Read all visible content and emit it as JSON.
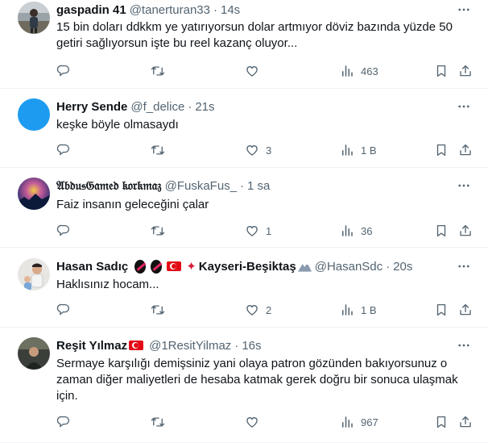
{
  "tweets": [
    {
      "name": "gaspadin 41",
      "handle": "@tanerturan33",
      "time": "14s",
      "text_lines": [
        "15 bin doları ddkkm ye yatırıyorsun dolar artmıyor döviz bazında yüzde 50",
        "getiri sağlıyorsun işte bu reel kazanç oluyor..."
      ],
      "likes": "",
      "views": "463",
      "avatar": "photo-avatar"
    },
    {
      "name": "Herry Sende",
      "handle": "@f_delice",
      "time": "21s",
      "text_lines": [
        "keşke böyle olmasaydı"
      ],
      "likes": "3",
      "views": "1 B",
      "avatar": "blue-circle-avatar",
      "avatar_color": "#1d9bf0"
    },
    {
      "name": "𝔄𝔟𝔡𝔲𝔰𝔊𝔞𝔪𝔢𝔡 𝔨𝔬𝔯𝔨𝔪𝔞𝔷",
      "handle": "@FuskaFus_",
      "time": "1 sa",
      "text_lines": [
        "Faiz insanın geleceğini çalar"
      ],
      "likes": "1",
      "views": "36",
      "avatar": "galaxy-avatar"
    },
    {
      "name": "Hasan Sadıç",
      "name_suffix": "Kayseri-Beşiktaş",
      "handle": "@HasanSdc",
      "time": "20s",
      "text_lines": [
        "Haklısınız hocam..."
      ],
      "likes": "2",
      "views": "1 B",
      "avatar": "photo-avatar"
    },
    {
      "name": "Reşit Yılmaz",
      "handle": "@1ResitYilmaz",
      "time": "16s",
      "text_lines": [
        "Sermaye karşılığı demişsiniz yani olaya patron gözünden bakıyorsunuz o",
        "zaman diğer maliyetleri de hesaba katmak gerek doğru bir sonuca ulaşmak",
        "için."
      ],
      "likes": "",
      "views": "967",
      "avatar": "photo-avatar"
    }
  ],
  "colors": {
    "text": "#0f1419",
    "secondary": "#536471",
    "border": "#eff3f4",
    "blue": "#1d9bf0",
    "flag_red": "#e30a17"
  },
  "icons": [
    "reply-icon",
    "retweet-icon",
    "like-icon",
    "views-icon",
    "bookmark-icon",
    "share-icon",
    "more-icon"
  ]
}
